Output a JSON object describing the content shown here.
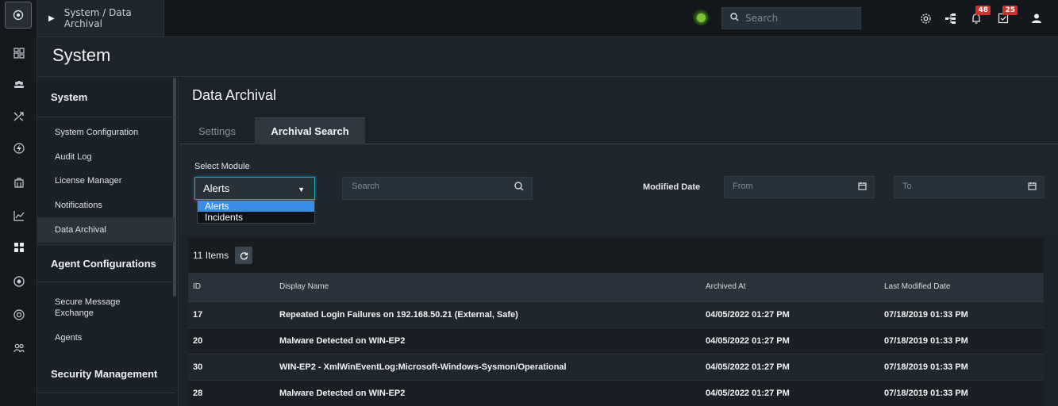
{
  "topbar": {
    "breadcrumb": "System / Data Archival",
    "search_placeholder": "Search",
    "notifications_count": "48",
    "tasks_count": "25"
  },
  "rail": {
    "icons": [
      "dashboard-icon",
      "users-group-icon",
      "shuffle-icon",
      "bolt-icon",
      "building-icon",
      "chart-icon",
      "grid-icon",
      "radar-icon",
      "globe-icon",
      "people-icon"
    ]
  },
  "system_header": {
    "title": "System"
  },
  "sidebar": {
    "sections": [
      {
        "label": "System"
      },
      {
        "label": "Agent Configurations"
      },
      {
        "label": "Security Management"
      }
    ],
    "items": [
      {
        "label": "System Configuration"
      },
      {
        "label": "Audit Log"
      },
      {
        "label": "License Manager"
      },
      {
        "label": "Notifications"
      },
      {
        "label": "Data Archival"
      },
      {
        "label": "Secure Message Exchange"
      },
      {
        "label": "Agents"
      }
    ]
  },
  "main": {
    "title": "Data Archival",
    "tabs": [
      {
        "label": "Settings"
      },
      {
        "label": "Archival Search"
      }
    ],
    "filters": {
      "module_label": "Select Module",
      "module_value": "Alerts",
      "module_options": [
        "Alerts",
        "Incidents"
      ],
      "search_placeholder": "Search",
      "modified_date_label": "Modified Date",
      "from_placeholder": "From",
      "to_placeholder": "To"
    },
    "grid": {
      "items_count": "11 Items",
      "columns": [
        "ID",
        "Display Name",
        "Archived At",
        "Last Modified Date"
      ],
      "rows": [
        [
          "17",
          "Repeated Login Failures on 192.168.50.21 (External, Safe)",
          "04/05/2022 01:27 PM",
          "07/18/2019 01:33 PM"
        ],
        [
          "20",
          "Malware Detected on WIN-EP2",
          "04/05/2022 01:27 PM",
          "07/18/2019 01:33 PM"
        ],
        [
          "30",
          "WIN-EP2 - XmlWinEventLog:Microsoft-Windows-Sysmon/Operational",
          "04/05/2022 01:27 PM",
          "07/18/2019 01:33 PM"
        ],
        [
          "28",
          "Malware Detected on WIN-EP2",
          "04/05/2022 01:27 PM",
          "07/18/2019 01:33 PM"
        ]
      ]
    }
  },
  "colors": {
    "accent": "#2fa3c7",
    "selected_option": "#3b8ce6",
    "badge": "#d0312d",
    "status_online": "#7cc233"
  }
}
